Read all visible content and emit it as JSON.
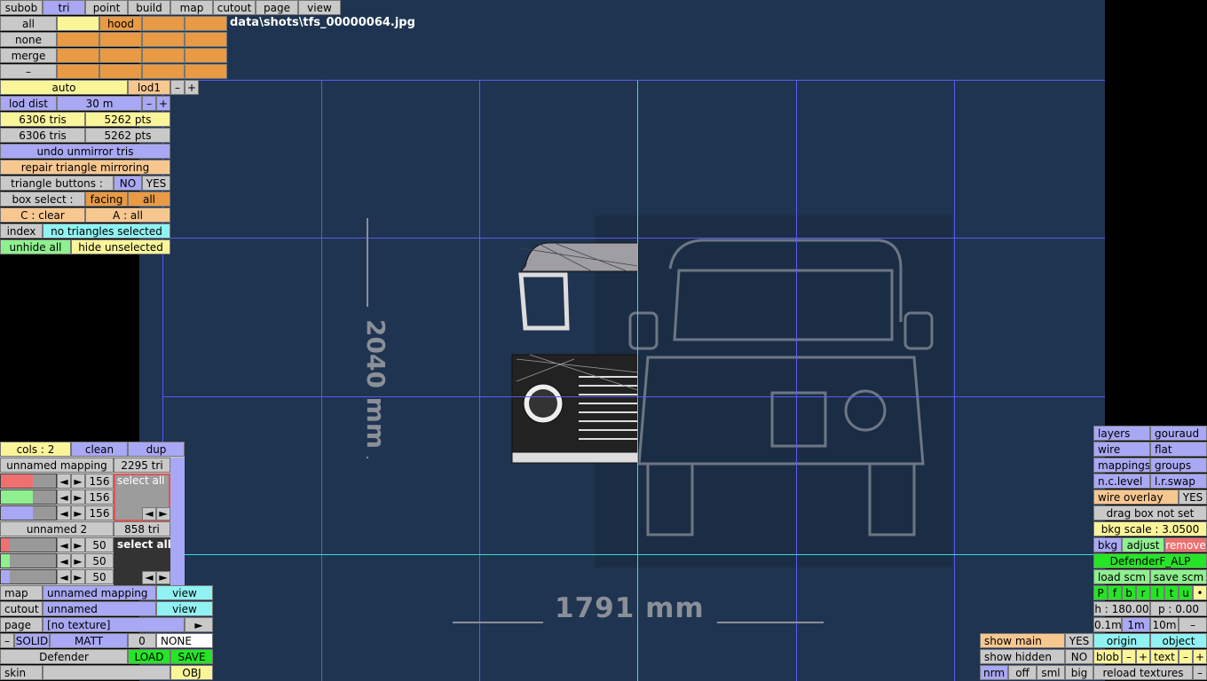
{
  "menu": {
    "subob": "subob",
    "tri": "tri",
    "point": "point",
    "build": "build",
    "map": "map",
    "cutout": "cutout",
    "page": "page",
    "view": "view"
  },
  "parts": {
    "all": "all",
    "hood": "hood",
    "none": "none",
    "merge": "merge",
    "minus": "–"
  },
  "lod": {
    "auto": "auto",
    "lod1": "lod1",
    "minus": "–",
    "plus": "+",
    "dist_label": "lod dist",
    "dist_value": "30 m"
  },
  "stats": {
    "tris1": "6306 tris",
    "pts1": "5262 pts",
    "tris2": "6306 tris",
    "pts2": "5262 pts"
  },
  "tools": {
    "undo_unmirror": "undo unmirror tris",
    "repair_mirror": "repair triangle mirroring",
    "tri_buttons": "triangle buttons :",
    "no": "NO",
    "yes": "YES",
    "box_select": "box select :",
    "facing": "facing",
    "all": "all",
    "c_clear": "C : clear",
    "a_all": "A : all",
    "index": "index",
    "no_tri_sel": "no triangles selected",
    "unhide_all": "unhide all",
    "hide_unselected": "hide unselected"
  },
  "shot_path": "data\\shots\\tfs_00000064.jpg",
  "dims": {
    "width": "1791 mm",
    "height": "2040 mm"
  },
  "mapping": {
    "cols": "cols : 2",
    "clean": "clean",
    "dup": "dup",
    "m1_name": "unnamed mapping",
    "m1_tri": "2295 tri",
    "v156a": "156",
    "v156b": "156",
    "v156c": "156",
    "select_all_1": "select all",
    "m2_name": "unnamed 2",
    "m2_tri": "858 tri",
    "v50a": "50",
    "v50b": "50",
    "v50c": "50",
    "select_all_2": "select all",
    "l_arrow": "◄",
    "r_arrow": "►"
  },
  "bottom_left": {
    "map": "map",
    "map_val": "unnamed mapping",
    "view1": "view",
    "cutout": "cutout",
    "cutout_val": "unnamed",
    "view2": "view",
    "page": "page",
    "page_val": "[no texture]",
    "play": "►",
    "dash": "–",
    "solid": "SOLID",
    "matt": "MATT",
    "zero": "0",
    "none": "NONE",
    "defender": "Defender",
    "load": "LOAD",
    "save": "SAVE",
    "skin": "skin",
    "obj": "OBJ"
  },
  "right": {
    "layers": "layers",
    "gouraud": "gouraud",
    "wire": "wire",
    "flat": "flat",
    "mappings": "mappings",
    "groups": "groups",
    "nclevel": "n.c.level",
    "lrswap": "l.r.swap",
    "wire_overlay": "wire overlay",
    "yes": "YES",
    "drag_box": "drag box not set",
    "bkg_scale": "bkg scale : 3.0500",
    "bkg": "bkg",
    "adjust": "adjust",
    "remove": "remove",
    "model": "DefenderF_ALP",
    "load_scm": "load scm",
    "save_scm": "save scm",
    "flags": [
      "P",
      "f",
      "b",
      "r",
      "l",
      "t",
      "u",
      "•"
    ],
    "h": "h : 180.00",
    "p": "p : 0.00",
    "s01": "0.1m",
    "s1": "1m",
    "s10": "10m",
    "sminus": "–",
    "origin": "origin",
    "object": "object",
    "blob": "blob",
    "text": "text",
    "reload": "reload textures",
    "rminus": "–",
    "minus": "–",
    "plus": "+"
  },
  "show": {
    "main": "show main",
    "main_yes": "YES",
    "hidden": "show hidden",
    "hidden_no": "NO",
    "nrm": "nrm",
    "off": "off",
    "sml": "sml",
    "big": "big"
  }
}
